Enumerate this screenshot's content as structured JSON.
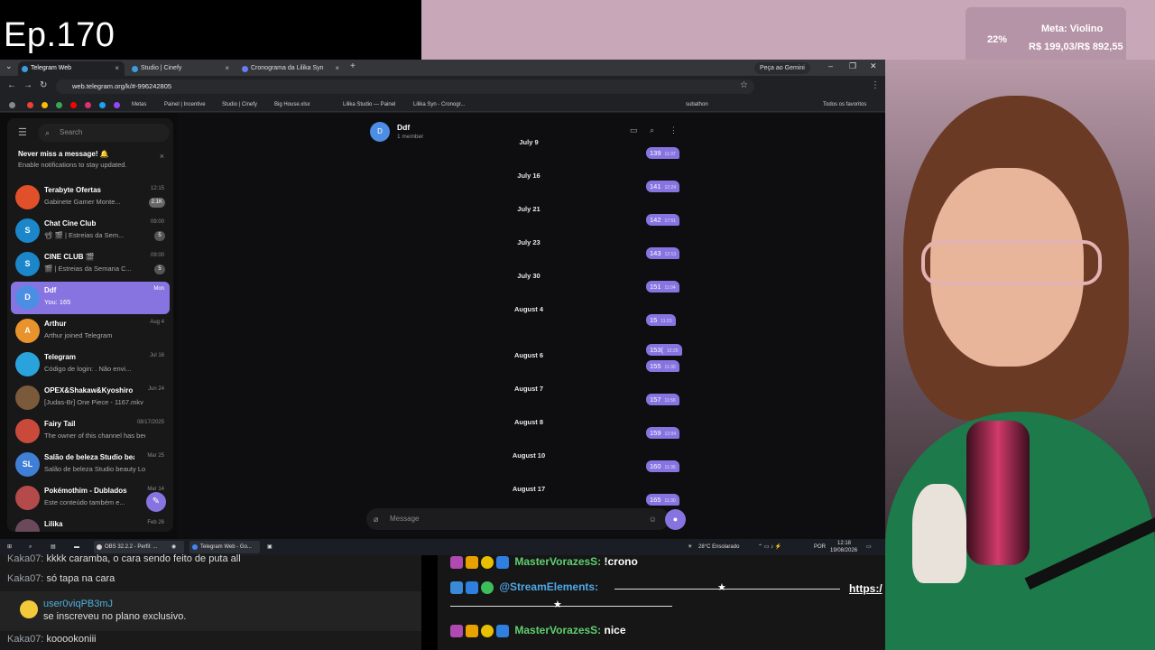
{
  "overlay": {
    "episode": "Ep.170",
    "goal_percent": "22%",
    "goal_title": "Meta: Violino",
    "goal_value": "R$ 199,03/R$ 892,55",
    "goal_fraction": 0.22
  },
  "browser": {
    "tabs": [
      {
        "label": "Telegram Web",
        "active": true
      },
      {
        "label": "Studio | Cinefy",
        "active": false
      },
      {
        "label": "Cronograma da Lilika Syn",
        "active": false
      }
    ],
    "gemini_label": "Peça ao Gemini",
    "url": "web.telegram.org/k/#-996242805",
    "bookmarks": [
      "Metas",
      "Painel | Incentive",
      "Studio | Cinefy",
      "Big House.xlsx",
      "Lilika Studio — Painel",
      "Lilika Syn - Cronogr...",
      "subathon"
    ],
    "all_bookmarks": "Todos os favoritos"
  },
  "telegram": {
    "search_placeholder": "Search",
    "notice_title": "Never miss a message! 🔔",
    "notice_sub": "Enable notifications to stay updated.",
    "chats": [
      {
        "initial": "",
        "name": "Terabyte Ofertas",
        "preview": "Gabinete Gamer Monte...",
        "time": "12:15",
        "badge": "2.1K",
        "color": "#e0502a"
      },
      {
        "initial": "S",
        "name": "Chat Cine Club",
        "preview": "📽 🎬 | Estreias da Sem...",
        "time": "09:00",
        "badge": "5",
        "color": "#1b86c9"
      },
      {
        "initial": "S",
        "name": "CINE CLUB 🎬",
        "preview": "🎬 | Estreias da Semana C...",
        "time": "09:00",
        "badge": "5",
        "color": "#1b86c9"
      },
      {
        "initial": "D",
        "name": "Ddf",
        "preview": "You: 165",
        "time": "Mon",
        "badge": "",
        "color": "#4d8ee5"
      },
      {
        "initial": "A",
        "name": "Arthur",
        "preview": "Arthur joined Telegram",
        "time": "Aug 4",
        "badge": "",
        "color": "#e8932b"
      },
      {
        "initial": "",
        "name": "Telegram",
        "preview": "Código de login: . Não envi...",
        "time": "Jul 16",
        "badge": "",
        "color": "#2aa3dd"
      },
      {
        "initial": "",
        "name": "OPEX&Shakaw&Kyoshiro ac...",
        "preview": "[Judas-Br] One Piece - 1167.mkv",
        "time": "Jun 24",
        "badge": "",
        "color": "#7a5a3a"
      },
      {
        "initial": "",
        "name": "Fairy Tail",
        "preview": "The owner of this channel has bee...",
        "time": "08/17/2025",
        "badge": "",
        "color": "#c94a3a"
      },
      {
        "initial": "SL",
        "name": "Salão de beleza Studio beau...",
        "preview": "Salão de beleza Studio beauty Lov...",
        "time": "Mar 25",
        "badge": "",
        "color": "#3f7fd6"
      },
      {
        "initial": "",
        "name": "Pokémothim - Dublados",
        "preview": "Este conteúdo também e...",
        "time": "Mar 14",
        "badge": "",
        "color": "#b54a4a"
      },
      {
        "initial": "",
        "name": "Lilika",
        "preview": "",
        "time": "Feb 26",
        "badge": "",
        "color": "#6a4a5a"
      }
    ],
    "header": {
      "initial": "D",
      "name": "Ddf",
      "status": "1 member"
    },
    "messages": [
      {
        "date": "July 9",
        "text": "139",
        "time": "11:37"
      },
      {
        "date": "July 16",
        "text": "141",
        "time": "12:24"
      },
      {
        "date": "July 21",
        "text": "142",
        "time": "17:51"
      },
      {
        "date": "July 23",
        "text": "143",
        "time": "12:13"
      },
      {
        "date": "July 30",
        "text": "151",
        "time": "11:04"
      },
      {
        "date": "August 4",
        "text": "15",
        "time": "11:23"
      },
      {
        "date": "",
        "text": "153(",
        "time": "12:25"
      },
      {
        "date": "August 6",
        "text": "155",
        "time": "11:30"
      },
      {
        "date": "August 7",
        "text": "157",
        "time": "11:56"
      },
      {
        "date": "August 8",
        "text": "159",
        "time": "12:04"
      },
      {
        "date": "August 10",
        "text": "160",
        "time": "11:36"
      },
      {
        "date": "August 17",
        "text": "165",
        "time": "11:30"
      }
    ],
    "composer_placeholder": "Message"
  },
  "taskbar": {
    "items": [
      "OBS 32.2.2 - Perfil: ...",
      "Telegram Web - Go..."
    ],
    "weather": "28°C  Ensolarado",
    "lang": "POR",
    "time": "12:18",
    "date": "19/08/2026"
  },
  "chat_left": {
    "lines": [
      {
        "user": "Kaka07:",
        "text": "kkkk caramba, o cara sendo feito de puta all"
      },
      {
        "user": "Kaka07:",
        "text": "só tapa na cara"
      },
      {
        "user": "Kaka07:",
        "text": "kooookoniii"
      }
    ],
    "sub_user": "user0viqPB3mJ",
    "sub_text": "se inscreveu no plano exclusivo."
  },
  "chat_right": {
    "line1_user": "MasterVorazesS:",
    "line1_text": "!crono",
    "line2_user": "@StreamElements:",
    "line2_link": "https:/",
    "line3_user": "MasterVorazesS:",
    "line3_text": "nice"
  },
  "colors": {
    "accent": "#8774e1",
    "bg": "#0e0e10"
  }
}
